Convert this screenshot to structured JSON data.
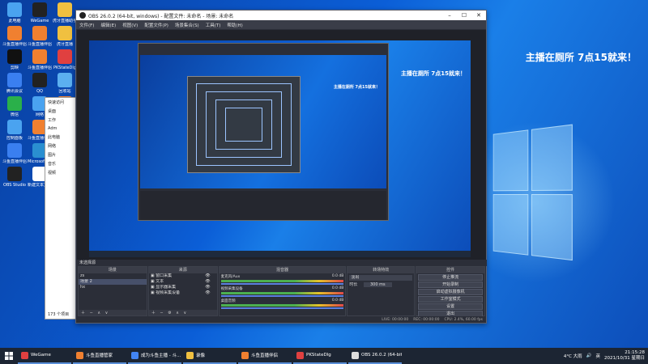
{
  "desktop": {
    "banner": "主播在厕所 7点15就来！",
    "icons": [
      {
        "label": "此电脑",
        "color": "#4aa3f0"
      },
      {
        "label": "WeGame",
        "color": "#222"
      },
      {
        "label": "虎牙直播助手",
        "color": "#f0c040"
      },
      {
        "label": "斗鱼直播伴侣",
        "color": "#f08030"
      },
      {
        "label": "斗鱼直播伴侣",
        "color": "#f08030"
      },
      {
        "label": "虎牙直播",
        "color": "#f0c040"
      },
      {
        "label": "剪映",
        "color": "#111"
      },
      {
        "label": "斗鱼直播伴侣",
        "color": "#f08030"
      },
      {
        "label": "PKStateDlg",
        "color": "#e04040"
      },
      {
        "label": "腾讯会议",
        "color": "#3a7ff0"
      },
      {
        "label": "QQ",
        "color": "#222"
      },
      {
        "label": "回收站",
        "color": "#5cb0f0"
      },
      {
        "label": "微信",
        "color": "#2ab04a"
      },
      {
        "label": "网络",
        "color": "#4aa3f0"
      },
      {
        "label": "斗鱼直播伴侣",
        "color": "#f08030"
      },
      {
        "label": "控制面板",
        "color": "#4aa3f0"
      },
      {
        "label": "斗鱼直播伴侣",
        "color": "#f08030"
      },
      {
        "label": "Google Chrome",
        "color": "#e04040"
      },
      {
        "label": "斗鱼直播伴侣",
        "color": "#3a7ff0"
      },
      {
        "label": "Microsoft Edge",
        "color": "#2a8fd0"
      },
      {
        "label": "腾讯QQ",
        "color": "#3a7ff0"
      },
      {
        "label": "OBS Studio",
        "color": "#222"
      },
      {
        "label": "新建文本文档",
        "color": "#fff"
      }
    ]
  },
  "explorer": {
    "rows": [
      "快速访问",
      "桌面",
      "工作",
      "Adm",
      "此电脑",
      "网络",
      "图片",
      "音乐",
      "视频"
    ],
    "count": "173 个项目"
  },
  "obs": {
    "title": "OBS 26.0.2 (64-bit, windows) - 配置文件: 未命名 - 场景: 未命名",
    "menu": [
      "文件(F)",
      "编辑(E)",
      "视图(V)",
      "配置文件(P)",
      "场景集合(S)",
      "工具(T)",
      "帮助(H)"
    ],
    "preview_banner": "主播在厕所 7点15就来！",
    "dock_label": "未选择源",
    "scenes": {
      "header": "场景",
      "items": [
        "zs",
        "场景 2",
        "hx"
      ],
      "selected": 1
    },
    "sources": {
      "header": "来源",
      "items": [
        "窗口采集",
        "文本",
        "显示器采集",
        "视频采集设备"
      ]
    },
    "mixer": {
      "header": "混音器",
      "tracks": [
        {
          "name": "麦克风/Aux",
          "db": "0.0 dB"
        },
        {
          "name": "视频采集设备",
          "db": "0.0 dB"
        },
        {
          "name": "桌面音频",
          "db": "0.0 dB"
        }
      ]
    },
    "transitions": {
      "header": "转场特效",
      "type": "淡出",
      "duration_label": "时长",
      "duration": "300 ms"
    },
    "controls": {
      "header": "控件",
      "buttons": [
        "停止推流",
        "开始录制",
        "启动虚拟摄像机",
        "工作室模式",
        "设置",
        "退出"
      ]
    },
    "status": {
      "live": "LIVE: 00:00:00",
      "rec": "REC: 00:00:00",
      "cpu": "CPU: 2.4%, 60.00 fps"
    }
  },
  "taskbar": {
    "items": [
      {
        "label": "WeGame",
        "color": "#e04040"
      },
      {
        "label": "斗鱼直播管家",
        "color": "#f08030"
      },
      {
        "label": "成为斗鱼主播 - 斗...",
        "color": "#4285f4"
      },
      {
        "label": "录像",
        "color": "#f0c040"
      },
      {
        "label": "斗鱼直播伴侣",
        "color": "#f08030"
      },
      {
        "label": "PKStateDlg",
        "color": "#e04040"
      },
      {
        "label": "OBS 26.0.2 (64-bit...",
        "color": "#ddd"
      }
    ],
    "weather": "4°C 大雨",
    "input": "英",
    "time": "21:15:28",
    "date": "2021/10/31 星期日"
  }
}
